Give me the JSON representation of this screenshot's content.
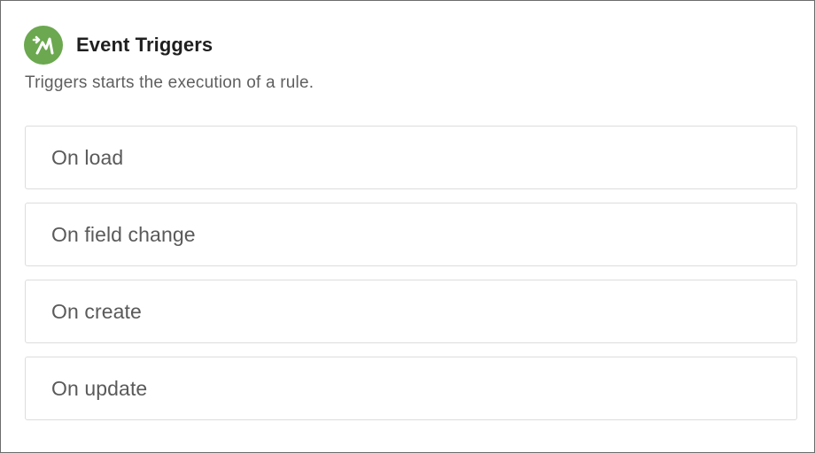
{
  "header": {
    "logo_icon": "mendix-logo-icon",
    "title": "Event Triggers",
    "subtitle": "Triggers starts the execution of a rule."
  },
  "triggers": [
    {
      "label": "On load"
    },
    {
      "label": "On field change"
    },
    {
      "label": "On create"
    },
    {
      "label": "On update"
    }
  ],
  "colors": {
    "accent": "#6ba84f",
    "border": "#dddddd",
    "title_text": "#1f1f1f",
    "body_text": "#5a5a5a"
  }
}
